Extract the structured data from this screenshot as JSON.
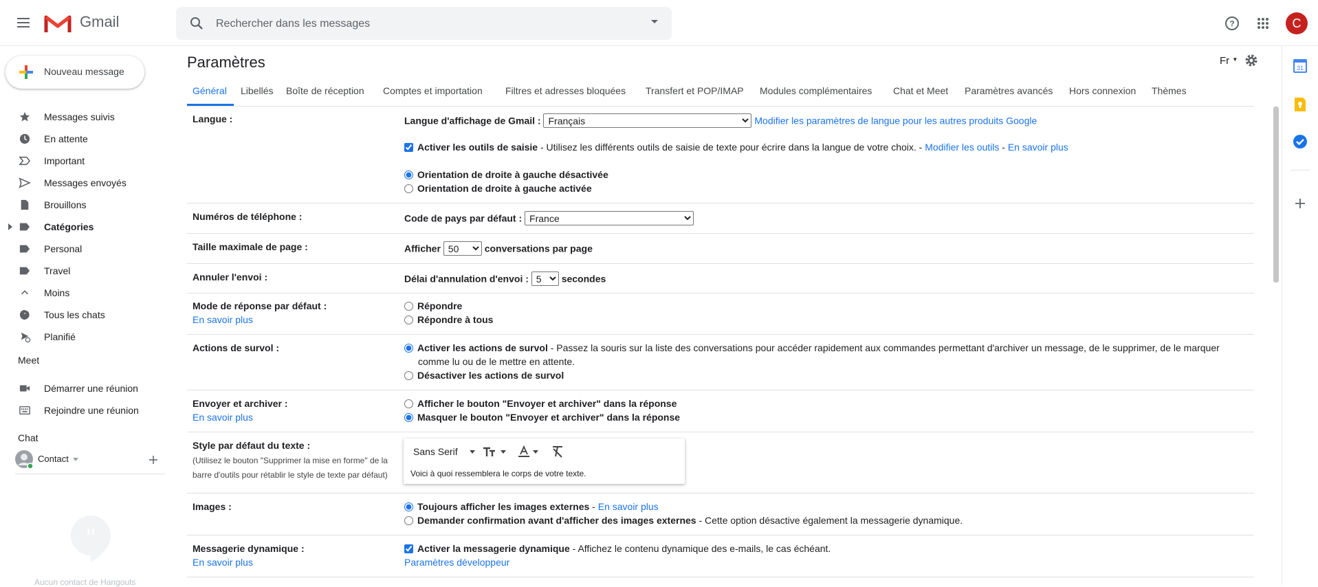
{
  "header": {
    "app_name": "Gmail",
    "search_placeholder": "Rechercher dans les messages",
    "avatar_letter": "C"
  },
  "compose": {
    "label": "Nouveau message"
  },
  "sidebar": {
    "items": [
      {
        "label": "Messages suivis",
        "icon": "star-icon"
      },
      {
        "label": "En attente",
        "icon": "clock-icon"
      },
      {
        "label": "Important",
        "icon": "important-icon"
      },
      {
        "label": "Messages envoyés",
        "icon": "send-icon"
      },
      {
        "label": "Brouillons",
        "icon": "draft-icon"
      },
      {
        "label": "Catégories",
        "icon": "label-icon"
      },
      {
        "label": "Personal",
        "icon": "label-icon"
      },
      {
        "label": "Travel",
        "icon": "label-icon"
      },
      {
        "label": "Moins",
        "icon": "chevron-up-icon"
      },
      {
        "label": "Tous les chats",
        "icon": "chat-icon"
      },
      {
        "label": "Planifié",
        "icon": "scheduled-icon"
      }
    ],
    "meet_title": "Meet",
    "meet_items": [
      {
        "label": "Démarrer une réunion",
        "icon": "video-icon"
      },
      {
        "label": "Rejoindre une réunion",
        "icon": "keyboard-icon"
      }
    ],
    "chat_title": "Chat",
    "contact_label": "Contact",
    "hangouts_empty": "Aucun contact de Hangouts"
  },
  "main": {
    "title": "Paramètres",
    "language_indicator": "Fr",
    "tabs": [
      {
        "label": "Général"
      },
      {
        "label": "Libellés"
      },
      {
        "label": "Boîte de réception"
      },
      {
        "label": "Comptes et importation"
      },
      {
        "label": "Filtres et adresses bloquées"
      },
      {
        "label": "Transfert et POP/IMAP"
      },
      {
        "label": "Modules complémentaires"
      },
      {
        "label": "Chat et Meet"
      },
      {
        "label": "Paramètres avancés"
      },
      {
        "label": "Hors connexion"
      },
      {
        "label": "Thèmes"
      }
    ],
    "settings": {
      "langue": {
        "label": "Langue :",
        "display_label": "Langue d'affichage de Gmail :",
        "display_value": "Français",
        "other_link": "Modifier les paramètres de langue pour les autres produits Google",
        "input_tools_label": "Activer les outils de saisie",
        "input_tools_desc": " - Utilisez les différents outils de saisie de texte pour écrire dans la langue de votre choix. - ",
        "modify_tools_link": "Modifier les outils",
        "sep": " - ",
        "learn_more": "En savoir plus",
        "rtl_off": "Orientation de droite à gauche désactivée",
        "rtl_on": "Orientation de droite à gauche activée"
      },
      "phone": {
        "label": "Numéros de téléphone :",
        "country_label": "Code de pays par défaut :",
        "country_value": "France"
      },
      "page_size": {
        "label": "Taille maximale de page :",
        "prefix": "Afficher",
        "value": "50",
        "suffix": "conversations par page"
      },
      "undo_send": {
        "label": "Annuler l'envoi :",
        "prefix": "Délai d'annulation d'envoi :",
        "value": "5",
        "suffix": "secondes"
      },
      "reply_mode": {
        "label": "Mode de réponse par défaut :",
        "learn_more": "En savoir plus",
        "reply": "Répondre",
        "reply_all": "Répondre à tous"
      },
      "hover": {
        "label": "Actions de survol :",
        "enable": "Activer les actions de survol",
        "enable_desc": " - Passez la souris sur la liste des conversations pour accéder rapidement aux commandes permettant d'archiver un message, de le supprimer, de le marquer",
        "enable_desc2": "comme lu ou de le mettre en attente.",
        "disable": "Désactiver les actions de survol"
      },
      "send_archive": {
        "label": "Envoyer et archiver :",
        "learn_more": "En savoir plus",
        "show": "Afficher le bouton \"Envoyer et archiver\" dans la réponse",
        "hide": "Masquer le bouton \"Envoyer et archiver\" dans la réponse"
      },
      "text_style": {
        "label": "Style par défaut du texte :",
        "hint_line1": "(Utilisez le bouton \"Supprimer la mise en forme\" de la",
        "hint_line2": "barre d'outils pour rétablir le style de texte par défaut)",
        "font": "Sans Serif",
        "preview": "Voici à quoi ressemblera le corps de votre texte."
      },
      "images": {
        "label": "Images :",
        "always": "Toujours afficher les images externes",
        "sep": " - ",
        "learn_more": "En savoir plus",
        "ask": "Demander confirmation avant d'afficher des images externes",
        "ask_desc": " - Cette option désactive également la messagerie dynamique."
      },
      "dynamic": {
        "label": "Messagerie dynamique :",
        "learn_more": "En savoir plus",
        "enable": "Activer la messagerie dynamique",
        "enable_desc": " - Affichez le contenu dynamique des e-mails, le cas échéant.",
        "dev_link": "Paramètres développeur"
      }
    }
  },
  "colors": {
    "accent": "#1a73e8",
    "avatar": "#c5221f"
  }
}
